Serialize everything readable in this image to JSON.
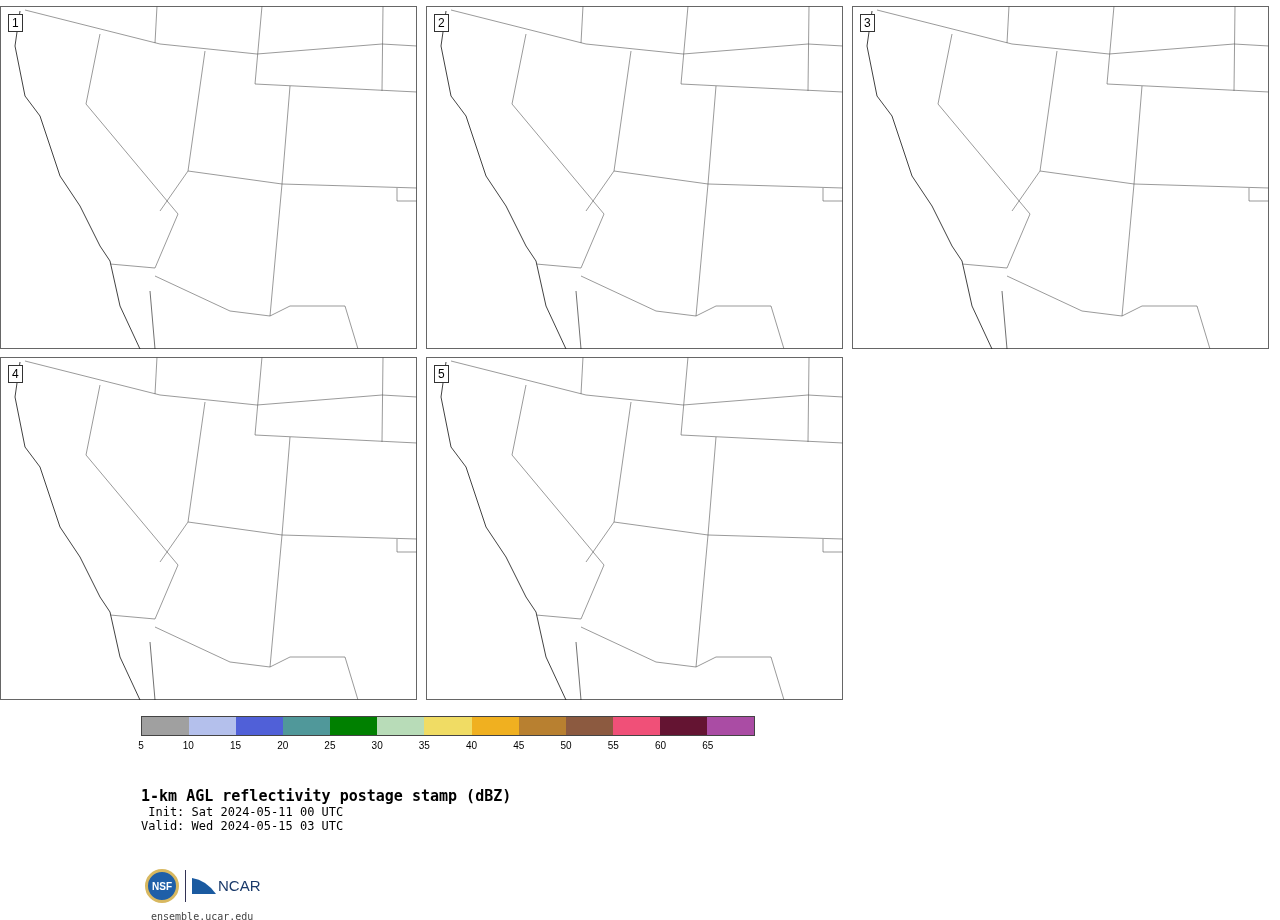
{
  "panels": [
    {
      "label": "1"
    },
    {
      "label": "2"
    },
    {
      "label": "3"
    },
    {
      "label": "4"
    },
    {
      "label": "5"
    }
  ],
  "colorbar": {
    "bins": [
      {
        "color": "#a0a0a0",
        "label": "5"
      },
      {
        "color": "#b4c0ec",
        "label": "10"
      },
      {
        "color": "#5060d8",
        "label": "15"
      },
      {
        "color": "#50989a",
        "label": "20"
      },
      {
        "color": "#008000",
        "label": "25"
      },
      {
        "color": "#b8dcb8",
        "label": "30"
      },
      {
        "color": "#f0dc64",
        "label": "35"
      },
      {
        "color": "#f0b020",
        "label": "40"
      },
      {
        "color": "#b88030",
        "label": "45"
      },
      {
        "color": "#8c5a40",
        "label": "50"
      },
      {
        "color": "#f05078",
        "label": "55"
      },
      {
        "color": "#641432",
        "label": "60"
      },
      {
        "color": "#aa4ca4",
        "label": "65"
      }
    ]
  },
  "title": "1-km AGL reflectivity postage stamp (dBZ)",
  "init": " Init: Sat 2024-05-11 00 UTC",
  "valid": "Valid: Wed 2024-05-15 03 UTC",
  "logo": {
    "left": "NSF",
    "right": "NCAR"
  },
  "url": "ensemble.ucar.edu"
}
